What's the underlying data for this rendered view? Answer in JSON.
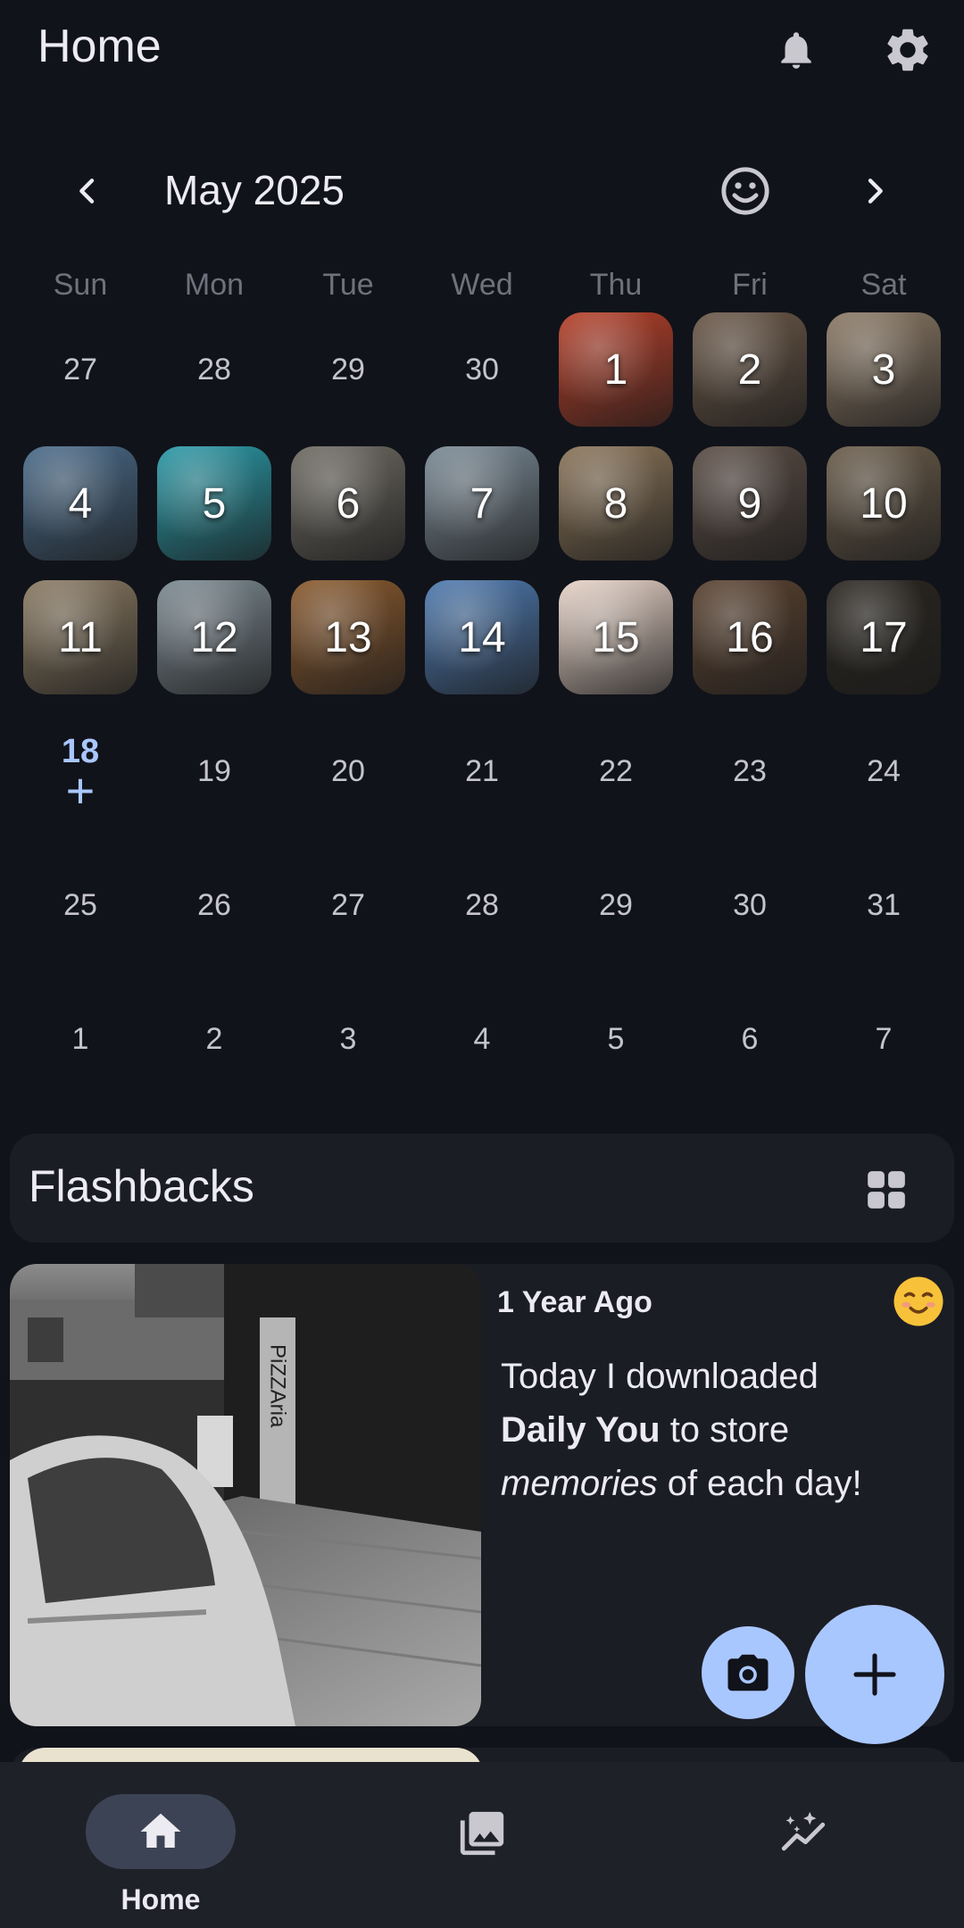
{
  "app": {
    "title": "Home"
  },
  "calendar": {
    "month_label": "May 2025",
    "weekdays": [
      "Sun",
      "Mon",
      "Tue",
      "Wed",
      "Thu",
      "Fri",
      "Sat"
    ],
    "weeks": [
      [
        "27",
        "28",
        "29",
        "30",
        "1",
        "2",
        "3"
      ],
      [
        "4",
        "5",
        "6",
        "7",
        "8",
        "9",
        "10"
      ],
      [
        "11",
        "12",
        "13",
        "14",
        "15",
        "16",
        "17"
      ],
      [
        "18",
        "19",
        "20",
        "21",
        "22",
        "23",
        "24"
      ],
      [
        "25",
        "26",
        "27",
        "28",
        "29",
        "30",
        "31"
      ],
      [
        "1",
        "2",
        "3",
        "4",
        "5",
        "6",
        "7"
      ]
    ],
    "today": "18",
    "today_plus": "+",
    "photo_tints": [
      "#b8402a",
      "#6b5848",
      "#8c7a66",
      "#4a6b8a",
      "#2a9aa8",
      "#6e6a62",
      "#7a8a96",
      "#8a7458",
      "#5a4c44",
      "#6a5c4a",
      "#8a7a62",
      "#7c8a92",
      "#8a5a2e",
      "#4e7ab0",
      "#e8d4c8",
      "#5a4230",
      "#2a2620"
    ]
  },
  "flashbacks": {
    "title": "Flashbacks",
    "card": {
      "ago": "1 Year Ago",
      "mood": "☺",
      "text_1": "Today I downloaded",
      "text_bold": "Daily You",
      "text_2": " to store",
      "text_italic": "memories",
      "text_3": " of each day!",
      "photo_sign": "PiZZAria"
    }
  },
  "bottom_nav": {
    "items": [
      {
        "label": "Home",
        "icon": "home-icon"
      },
      {
        "label": "",
        "icon": "gallery-icon"
      },
      {
        "label": "",
        "icon": "insights-icon"
      }
    ]
  },
  "colors": {
    "accent": "#a9c7ff",
    "background": "#11131a",
    "surface": "#1b1d24"
  }
}
